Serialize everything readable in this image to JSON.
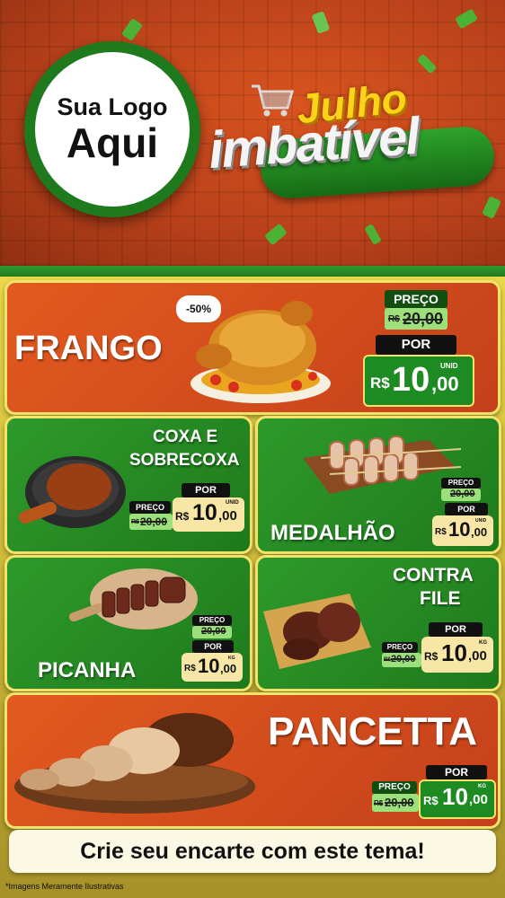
{
  "header": {
    "logo_line1": "Sua Logo",
    "logo_line2": "Aqui",
    "brand_line1": "Julho",
    "brand_line2": "imbatível"
  },
  "labels": {
    "preco": "PREÇO",
    "por": "POR",
    "currency": "R$"
  },
  "products": [
    {
      "id": "frango",
      "name": "FRANGO",
      "discount": "-50%",
      "old_price": "20,00",
      "new_price_int": "10",
      "new_price_dec": ",00",
      "unit": "UNID"
    },
    {
      "id": "coxa",
      "name_line1": "COXA E",
      "name_line2": "SOBRECOXA",
      "old_price": "20,00",
      "new_price_int": "10",
      "new_price_dec": ",00",
      "unit": "UNID"
    },
    {
      "id": "medalhao",
      "name": "MEDALHÃO",
      "old_price": "20,00",
      "new_price_int": "10",
      "new_price_dec": ",00",
      "unit": "UNID"
    },
    {
      "id": "picanha",
      "name": "PICANHA",
      "old_price": "20,00",
      "new_price_int": "10",
      "new_price_dec": ",00",
      "unit": "KG"
    },
    {
      "id": "contrafile",
      "name_line1": "CONTRA",
      "name_line2": "FILE",
      "old_price": "20,00",
      "new_price_int": "10",
      "new_price_dec": ",00",
      "unit": "KG"
    },
    {
      "id": "pancetta",
      "name": "PANCETTA",
      "old_price": "20,00",
      "new_price_int": "10",
      "new_price_dec": ",00",
      "unit": "KG"
    }
  ],
  "cta": "Crie seu encarte com este tema!",
  "disclaimer": "*Imagens Meramente Ilustrativas",
  "colors": {
    "orange": "#d94d1d",
    "green": "#248a22",
    "yellow": "#ffd21a",
    "cream": "#f7e6a6"
  }
}
